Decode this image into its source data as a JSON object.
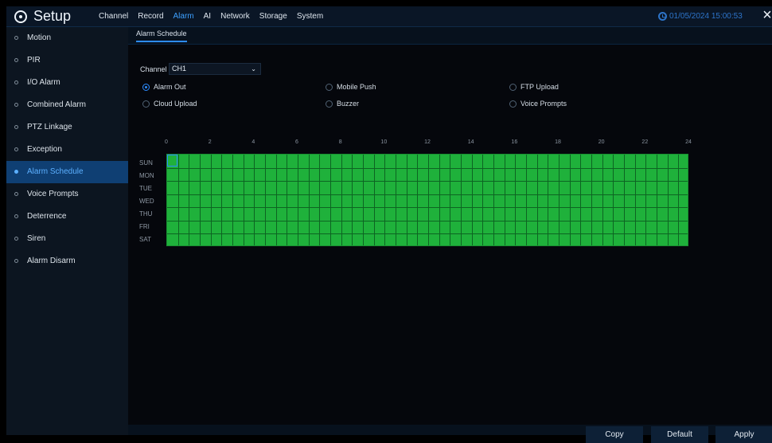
{
  "app": {
    "title": "Setup",
    "logo_icon": "gear-icon"
  },
  "top_menu": {
    "items": [
      {
        "label": "Channel"
      },
      {
        "label": "Record"
      },
      {
        "label": "Alarm",
        "active": true
      },
      {
        "label": "AI"
      },
      {
        "label": "Network"
      },
      {
        "label": "Storage"
      },
      {
        "label": "System"
      }
    ],
    "datetime": "01/05/2024 15:00:53"
  },
  "sidebar": {
    "items": [
      {
        "label": "Motion"
      },
      {
        "label": "PIR"
      },
      {
        "label": "I/O Alarm"
      },
      {
        "label": "Combined Alarm"
      },
      {
        "label": "PTZ Linkage"
      },
      {
        "label": "Exception"
      },
      {
        "label": "Alarm Schedule",
        "active": true
      },
      {
        "label": "Voice Prompts"
      },
      {
        "label": "Deterrence"
      },
      {
        "label": "Siren"
      },
      {
        "label": "Alarm Disarm"
      }
    ]
  },
  "main": {
    "tab": "Alarm Schedule",
    "channel_label": "Channel",
    "channel_value": "CH1",
    "options": [
      {
        "label": "Alarm Out",
        "selected": true
      },
      {
        "label": "Mobile Push",
        "selected": false
      },
      {
        "label": "FTP Upload",
        "selected": false
      },
      {
        "label": "Cloud Upload",
        "selected": false
      },
      {
        "label": "Buzzer",
        "selected": false
      },
      {
        "label": "Voice Prompts",
        "selected": false
      }
    ],
    "schedule": {
      "hour_labels": [
        "0",
        "2",
        "4",
        "6",
        "8",
        "10",
        "12",
        "14",
        "16",
        "18",
        "20",
        "22",
        "24"
      ],
      "days": [
        "SUN",
        "MON",
        "TUE",
        "WED",
        "THU",
        "FRI",
        "SAT"
      ],
      "color": "#1fb13b",
      "all_enabled": true
    },
    "buttons": {
      "copy": "Copy",
      "default": "Default",
      "apply": "Apply"
    }
  },
  "colors": {
    "accent": "#2d8cff",
    "highlight": "#0f3f73",
    "schedule_green": "#1fb13b"
  }
}
